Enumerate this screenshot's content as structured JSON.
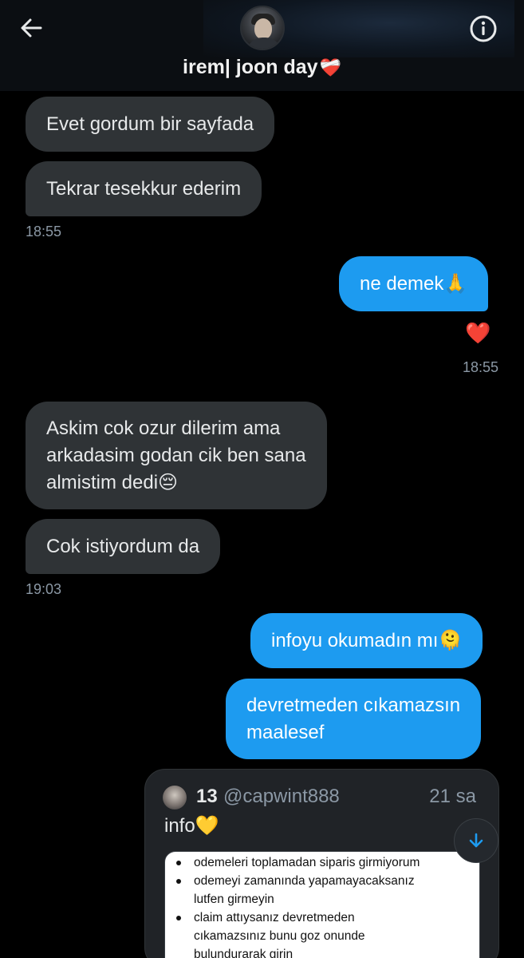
{
  "header": {
    "title": "irem| joon day",
    "title_emoji": "❤️‍🩹"
  },
  "messages": [
    {
      "side": "in",
      "text": "Evet gordum bir sayfada"
    },
    {
      "side": "in",
      "text": "Tekrar tesekkur ederim"
    },
    {
      "timestamp": "18:55"
    },
    {
      "side": "out",
      "text": "ne demek🙏"
    },
    {
      "reaction": "❤️"
    },
    {
      "timestamp": "18:55"
    },
    {
      "side": "in",
      "lines": [
        "Askim cok ozur dilerim ama",
        "arkadasim godan cik ben sana",
        "almistim dedi😔"
      ]
    },
    {
      "side": "in",
      "text": "Cok istiyordum da"
    },
    {
      "timestamp": "19:03"
    },
    {
      "side": "out",
      "text": "infoyu okumadın mı🫠"
    },
    {
      "side": "out",
      "lines": [
        "devretmeden cıkamazsın",
        "maalesef"
      ]
    }
  ],
  "quoted_tweet": {
    "name": "13",
    "handle": "@capwint888",
    "time": "21 sa",
    "text": "info💛",
    "image_items": [
      [
        "odemeleri toplamadan siparis girmiyorum"
      ],
      [
        "odemeyi zamanında yapamayacaksanız",
        "lutfen girmeyin"
      ],
      [
        "claim attıysanız devretmeden",
        "cıkamazsınız bunu goz onunde",
        "bulundurarak girin"
      ]
    ]
  },
  "colors": {
    "background": "#000000",
    "incoming_bubble": "#2f3336",
    "outgoing_bubble": "#1d9bf0",
    "timestamp": "#8b98a5"
  },
  "icons": [
    "back-arrow-icon",
    "info-icon",
    "arrow-down-icon"
  ]
}
